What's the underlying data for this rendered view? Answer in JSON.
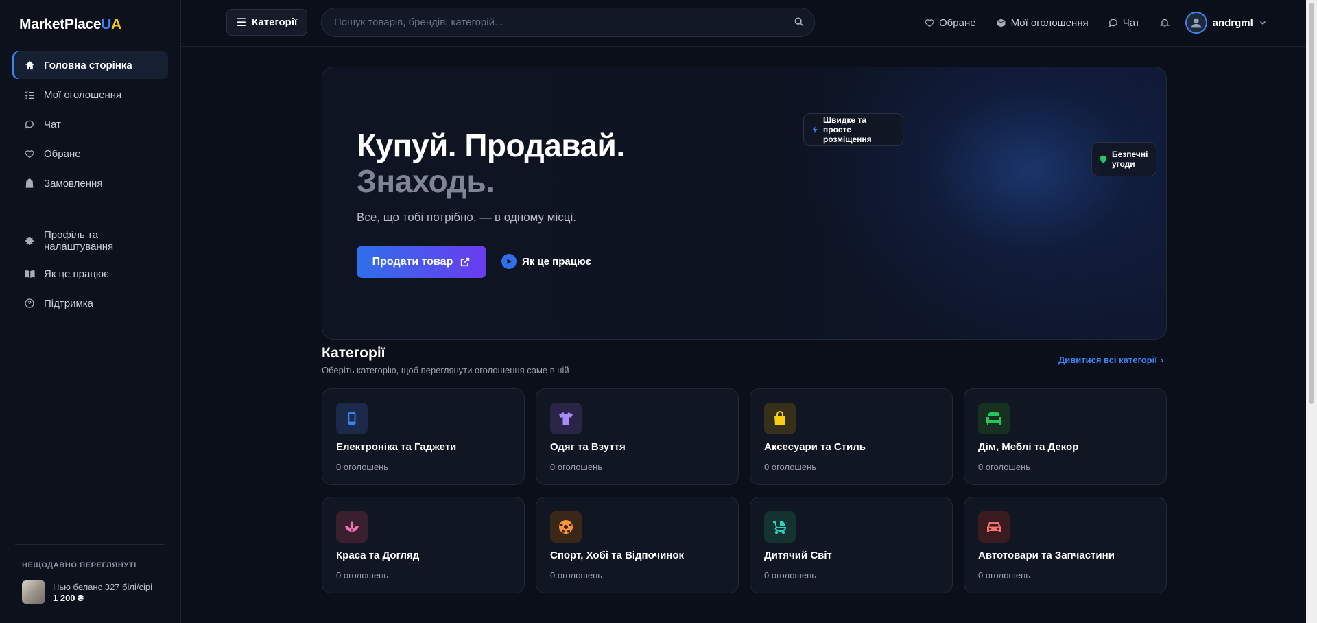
{
  "brand": {
    "name_main": "MarketPlace",
    "name_u": "U",
    "name_a": "A"
  },
  "sidebar": {
    "items": [
      {
        "label": "Головна сторінка",
        "icon": "home-icon",
        "active": true
      },
      {
        "label": "Мої оголошення",
        "icon": "list-icon"
      },
      {
        "label": "Чат",
        "icon": "chat-icon"
      },
      {
        "label": "Обране",
        "icon": "heart-icon"
      },
      {
        "label": "Замовлення",
        "icon": "bag-icon"
      }
    ],
    "secondary": [
      {
        "label_line1": "Профіль та",
        "label_line2": "налаштування",
        "icon": "gear-icon"
      },
      {
        "label": "Як це працює",
        "icon": "book-icon"
      },
      {
        "label": "Підтримка",
        "icon": "help-icon"
      }
    ],
    "recent": {
      "title": "НЕЩОДАВНО ПЕРЕГЛЯНУТІ",
      "item_name": "Нью беланс 327 білі/сірі",
      "item_price": "1 200 ₴"
    }
  },
  "topbar": {
    "categories_label": "Категорії",
    "search_placeholder": "Пошук товарів, брендів, категорій...",
    "favorites_label": "Обране",
    "my_ads_label": "Мої оголошення",
    "chat_label": "Чат",
    "username": "andrgml"
  },
  "hero": {
    "title_line1": "Купуй. Продавай.",
    "title_line2": "Знаходь.",
    "subtitle": "Все, що тобі потрібно, — в одному місці.",
    "sell_button": "Продати товар",
    "how_link": "Як це працює",
    "badge_fast_line1": "Швидке та просте",
    "badge_fast_line2": "розміщення",
    "badge_safe_line1": "Безпечні",
    "badge_safe_line2": "угоди"
  },
  "categories": {
    "heading": "Категорії",
    "subheading": "Оберіть категорію, щоб переглянути оголошення саме в ній",
    "all_link": "Дивитися всі категорії",
    "items": [
      {
        "title": "Електроніка та Гаджети",
        "count": "0 оголошень",
        "icon": "phone-icon",
        "tile_color": "#1b2a4a",
        "icon_color": "#3b82f6"
      },
      {
        "title": "Одяг та Взуття",
        "count": "0 оголошень",
        "icon": "tshirt-icon",
        "tile_color": "#2a2446",
        "icon_color": "#a78bfa"
      },
      {
        "title": "Аксесуари та Стиль",
        "count": "0 оголошень",
        "icon": "shopping-bag-icon",
        "tile_color": "#36301a",
        "icon_color": "#facc15"
      },
      {
        "title": "Дім, Меблі та Декор",
        "count": "0 оголошень",
        "icon": "sofa-icon",
        "tile_color": "#17301f",
        "icon_color": "#22c55e"
      },
      {
        "title": "Краса та Догляд",
        "count": "0 оголошень",
        "icon": "lotus-icon",
        "tile_color": "#3a1f2e",
        "icon_color": "#f472b6"
      },
      {
        "title": "Спорт, Хобі та Відпочинок",
        "count": "0 оголошень",
        "icon": "ball-icon",
        "tile_color": "#3a2718",
        "icon_color": "#fb923c"
      },
      {
        "title": "Дитячий Світ",
        "count": "0 оголошень",
        "icon": "stroller-icon",
        "tile_color": "#14322f",
        "icon_color": "#2dd4bf"
      },
      {
        "title": "Автотовари та Запчастини",
        "count": "0 оголошень",
        "icon": "car-icon",
        "tile_color": "#3a1c20",
        "icon_color": "#f87171"
      }
    ]
  }
}
